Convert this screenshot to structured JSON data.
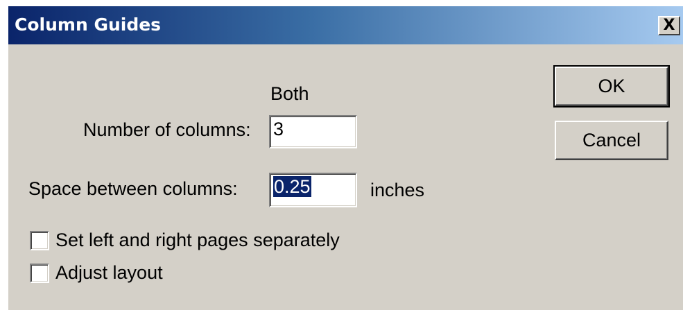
{
  "dialog": {
    "title": "Column Guides",
    "close_glyph": "X"
  },
  "form": {
    "group_header": "Both",
    "num_columns_label": "Number of columns:",
    "num_columns_value": "3",
    "space_label": "Space between columns:",
    "space_value": "0.25",
    "space_unit": "inches",
    "checkbox_separate_label": "Set left and right pages separately",
    "checkbox_separate_checked": false,
    "checkbox_adjust_label": "Adjust layout",
    "checkbox_adjust_checked": false
  },
  "buttons": {
    "ok_label": "OK",
    "cancel_label": "Cancel"
  },
  "colors": {
    "titlebar_start": "#0a246a",
    "titlebar_end": "#a6caf0",
    "dialog_bg": "#d4d0c8",
    "selection": "#0a246a"
  }
}
